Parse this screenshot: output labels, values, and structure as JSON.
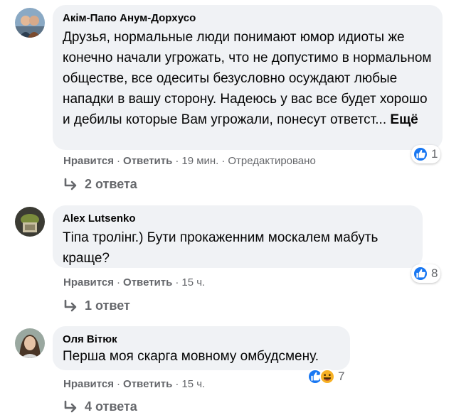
{
  "comments": [
    {
      "author": "Акім-Папо Анум-Дорхусо",
      "text": "Друзья, нормальные люди понимают юмор идиоты же конечно начали угрожать, что не допустимо в нормальном обществе, все одеситы безусловно осуждают любые нападки в вашу сторону. Надеюсь у вас все будет хорошо и дебилы которые Вам угрожали, понесут ответст...",
      "more_label": "Ещё",
      "reaction_count": "1",
      "reaction_icons": [
        "like-icon"
      ],
      "like_label": "Нравится",
      "reply_label": "Ответить",
      "time": "19 мин.",
      "edited_label": "Отредактировано",
      "replies_label": "2 ответа"
    },
    {
      "author": "Alex Lutsenko",
      "text": "Тіпа тролінг.) Бути прокаженним москалем мабуть краще?",
      "reaction_count": "8",
      "reaction_icons": [
        "like-icon"
      ],
      "like_label": "Нравится",
      "reply_label": "Ответить",
      "time": "15 ч.",
      "replies_label": "1 ответ"
    },
    {
      "author": "Оля Вітюк",
      "text": "Перша моя скарга мовному омбудсмену.",
      "reaction_count": "7",
      "reaction_icons": [
        "like-icon",
        "haha-icon"
      ],
      "like_label": "Нравится",
      "reply_label": "Ответить",
      "time": "15 ч.",
      "replies_label": "4 ответа"
    }
  ],
  "colors": {
    "bubble": "#f0f2f5",
    "secondary_text": "#65676b",
    "like_blue": "#1877f2",
    "haha_yellow": "#f7b125"
  }
}
